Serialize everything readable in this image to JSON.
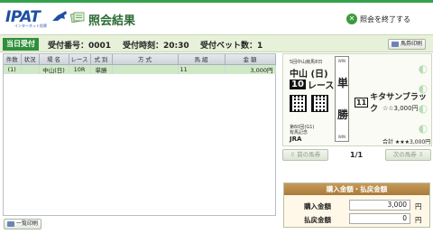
{
  "header": {
    "logo": "IPAT",
    "logo_sub": "インターネット投票",
    "title": "照会結果",
    "exit_label": "照会を終了する",
    "exit_icon": "close-circle-icon"
  },
  "infobar": {
    "today_tag": "当日受付",
    "receipt_no": "受付番号：0001",
    "receipt_time": "受付時刻：20:30",
    "bet_count": "受付ベット数：1",
    "print_ticket_label": "馬券印刷"
  },
  "table": {
    "headers": [
      "件数",
      "状況",
      "場 名",
      "レース",
      "式 別",
      "方 式",
      "馬 組",
      "金 額"
    ],
    "rows": [
      {
        "count": "(1)",
        "status": "",
        "place": "中山(日)",
        "race": "10R",
        "type": "単勝",
        "method": "",
        "combo": "11",
        "amount": "3,000円"
      }
    ],
    "print_list_label": "一覧印刷"
  },
  "ticket": {
    "line1": "5回中山競馬8日",
    "place": "中山 (日)",
    "race_num": "10",
    "race_suffix": "レース",
    "win_label": "WIN",
    "win_char1": "単",
    "win_char2": "勝",
    "horse_num": "11",
    "horse_name": "キタサンブラック",
    "amount": "☆☆3,000円",
    "meet": "第60回(G1)",
    "meet_name": "有馬記念",
    "jra": "JRA",
    "total": "合計 ★★★3,000円"
  },
  "nav": {
    "prev_label": "前の馬券",
    "next_label": "次の馬券",
    "page": "1/1"
  },
  "totals": {
    "title": "購入金額・払戻金額",
    "purchase_label": "購入金額",
    "purchase_value": "3,000",
    "payout_label": "払戻金額",
    "payout_value": "0",
    "unit": "円"
  },
  "colors": {
    "brand": "#2f8f3a",
    "logo": "#1f4fa3",
    "selected_row": "#cfe9c6"
  }
}
